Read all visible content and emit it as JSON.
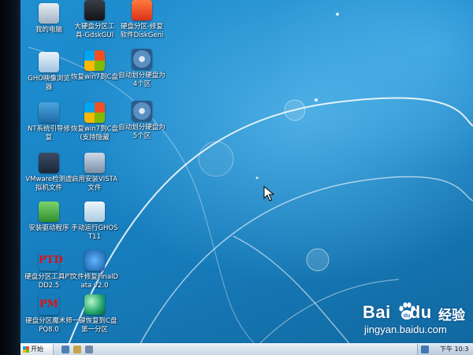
{
  "desktop": {
    "icons": [
      {
        "label": "我的电脑"
      },
      {
        "label": "大硬盘分区工具-GdskGUI"
      },
      {
        "label": "硬盘分区-修复软件DiskGeni"
      },
      {
        "label": "GHO映像浏览器"
      },
      {
        "label": "恢复win7到C盘"
      },
      {
        "label": "自动划分硬盘为4个区"
      },
      {
        "label": "NT系统引导修复"
      },
      {
        "label": "恢复win7到C盘(支持隐藏"
      },
      {
        "label": "自动划分硬盘为5个区"
      },
      {
        "label": "VMware检测虚拟机文件"
      },
      {
        "label": "启用安装VISTA文件"
      },
      {
        "label": "安装驱动程序"
      },
      {
        "label": "手动运行GHOST11"
      },
      {
        "label": "硬盘分区工具PTDD2.5"
      },
      {
        "label": "文件修复FinalData v2.0"
      },
      {
        "label": "硬盘分区魔术师PQ8.0"
      },
      {
        "label": "一键恢复到C盘第一分区"
      }
    ]
  },
  "watermark": {
    "brand_left": "Bai",
    "brand_right": "du",
    "brand_cn": "经验",
    "url": "jingyan.baidu.com"
  },
  "taskbar": {
    "start_label": "开始",
    "clock": "下午 10:3"
  },
  "colors": {
    "desktop_blue": "#1a86c8",
    "taskbar": "#dfe8f1"
  }
}
